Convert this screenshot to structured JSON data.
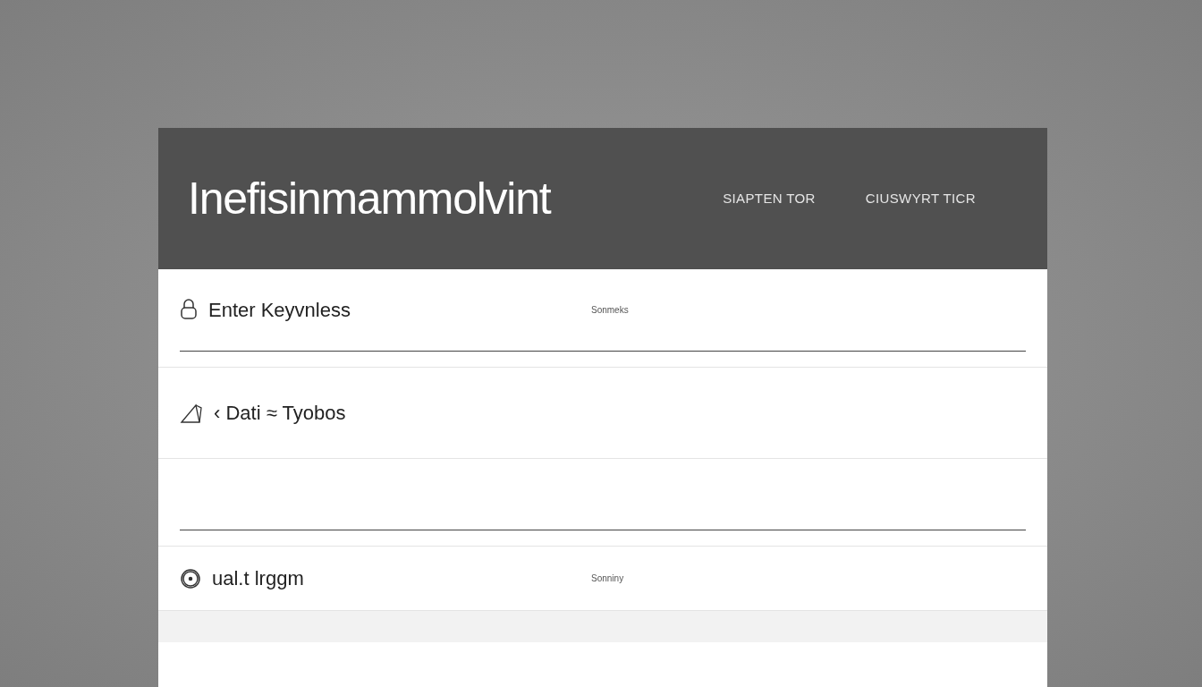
{
  "header": {
    "title": "Inefisinmammolvint",
    "nav": [
      "SIAPTEN TOR",
      "CIUSWYRT TICR"
    ]
  },
  "rows": [
    {
      "kind": "lock",
      "label": "Enter Keyvnless",
      "note": "Sonmeks",
      "underline": true
    },
    {
      "kind": "ruler",
      "label": "‹ Dati ≈ Tyobos",
      "underline": false
    },
    {
      "kind": "blank",
      "underline": true
    },
    {
      "kind": "clock",
      "label": "ual.t lrggm",
      "note": "Sonniny",
      "underline": false
    }
  ]
}
